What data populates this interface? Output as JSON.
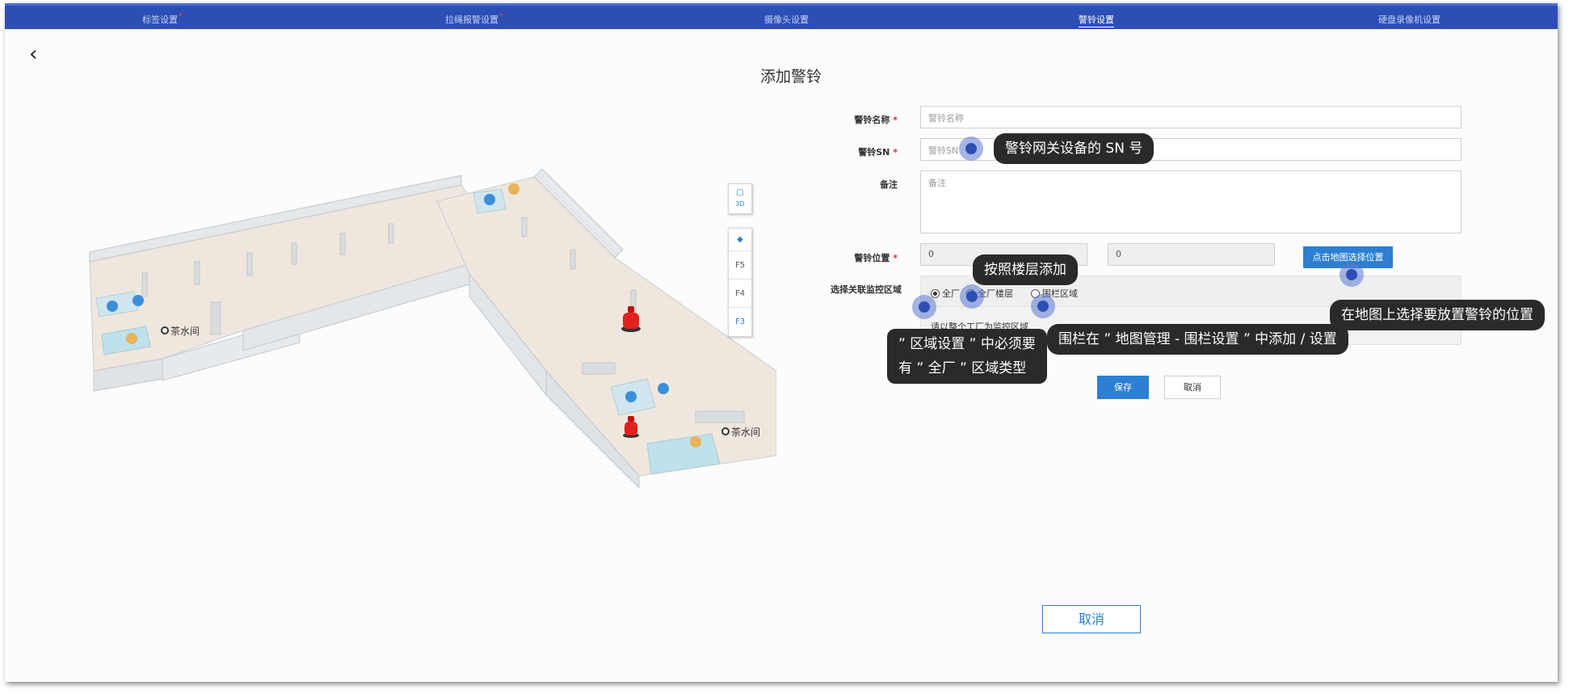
{
  "tabs": [
    {
      "label": "标签设置",
      "required": "*"
    },
    {
      "label": "拉绳报警设置",
      "required": "*"
    },
    {
      "label": "摄像头设置",
      "required": ""
    },
    {
      "label": "警铃设置",
      "required": ""
    },
    {
      "label": "硬盘录像机设置",
      "required": ""
    }
  ],
  "page": {
    "title": "添加警铃"
  },
  "map": {
    "view_3d_label": "3D",
    "floors": [
      "F5",
      "F4",
      "F3"
    ],
    "active_floor": "F3",
    "room_labels": [
      "茶水间",
      "茶水间"
    ]
  },
  "form": {
    "required_mark": "*",
    "name_label": "警铃名称",
    "name_placeholder": "警铃名称",
    "sn_label": "警铃SN",
    "sn_placeholder": "警铃SN",
    "remark_label": "备注",
    "remark_placeholder": "备注",
    "position_label": "警铃位置",
    "pos_x": "0",
    "pos_y": "0",
    "map_select_label": "点击地图选择位置",
    "scope_label": "选择关联监控区域",
    "scope_options": [
      "全厂",
      "全厂楼层",
      "围栏区域"
    ],
    "scope_note": "请以整个工厂为监控区域",
    "save_label": "保存",
    "cancel_label": "取消"
  },
  "footer": {
    "cancel_label": "取消"
  },
  "annotations": {
    "sn_tip": "警铃网关设备的 SN 号",
    "floor_tip": "按照楼层添加",
    "map_tip": "在地图上选择要放置警铃的位置",
    "fence_tip": "围栏在 ” 地图管理 - 围栏设置 ” 中添加 / 设置",
    "region_tip_1": "” 区域设置 ” 中必须要",
    "region_tip_2": "有 ” 全厂 ” 区域类型"
  },
  "colors": {
    "header": "#2d4fb5",
    "primary": "#2d7fd3",
    "tooltip": "#2a2a2a",
    "alarm": "#e22020"
  }
}
